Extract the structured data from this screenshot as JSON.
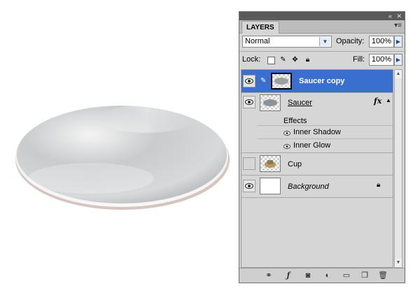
{
  "panel": {
    "tab_label": "LAYERS",
    "titlebar": {
      "collapse_icon": "«",
      "close_icon": "✕"
    },
    "menu_icon": "▾≡"
  },
  "controls": {
    "blend_mode": "Normal",
    "opacity_label": "Opacity:",
    "opacity_value": "100%",
    "lock_label": "Lock:",
    "fill_label": "Fill:",
    "fill_value": "100%"
  },
  "layers": [
    {
      "name": "Saucer copy",
      "visible": true,
      "selected": true
    },
    {
      "name": "Saucer",
      "visible": true,
      "fx": "fx",
      "effects_label": "Effects",
      "effects": [
        {
          "name": "Inner Shadow"
        },
        {
          "name": "Inner Glow"
        }
      ]
    },
    {
      "name": "Cup",
      "visible": false
    },
    {
      "name": "Background",
      "visible": true
    }
  ],
  "bottom_icons": [
    "link-icon",
    "fx-icon",
    "mask-icon",
    "adjustment-icon",
    "folder-icon",
    "new-layer-icon",
    "trash-icon"
  ],
  "colors": {
    "selected_row": "#3a6fd0",
    "panel_bg": "#d6d6d6"
  }
}
